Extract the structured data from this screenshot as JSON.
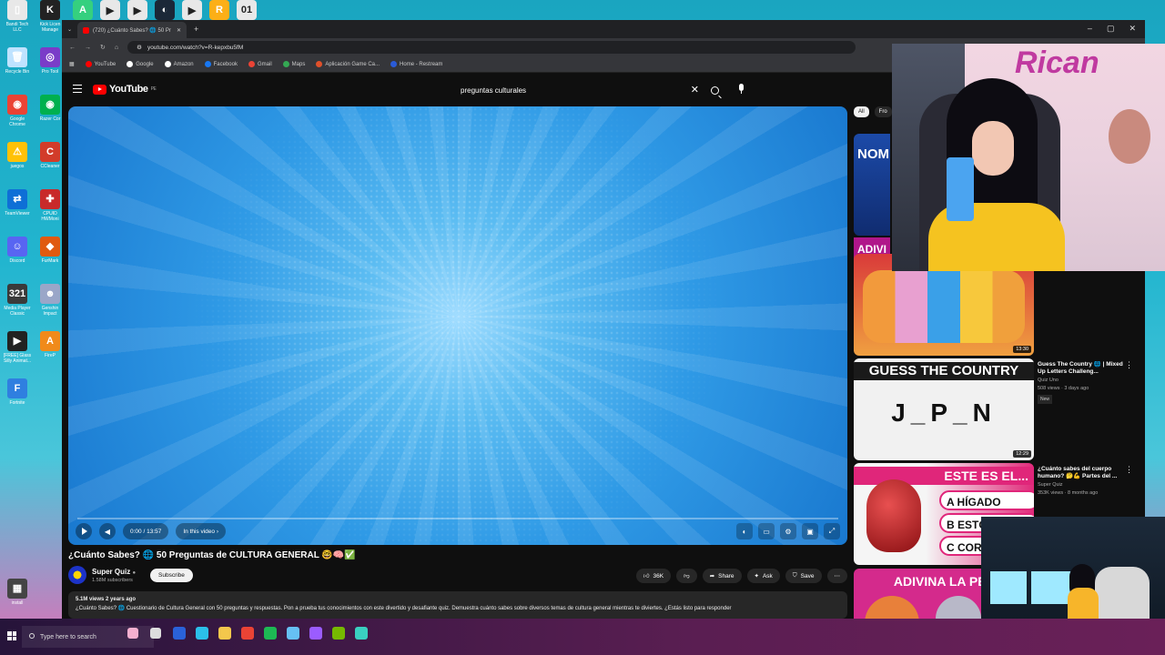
{
  "desktop": {
    "icons_col1": [
      {
        "label": "Bandi Tech LLC",
        "color": "#e8e8e8",
        "glyph": "▯"
      },
      {
        "label": "Recycle Bin",
        "color": "#bfe3ff",
        "glyph": "🗑"
      },
      {
        "label": "Google Chrome",
        "color": "#ea4335",
        "glyph": "◉"
      },
      {
        "label": "juegos",
        "color": "#ffc107",
        "glyph": "⚠"
      },
      {
        "label": "TeamViewer",
        "color": "#0e6fd6",
        "glyph": "⇄"
      },
      {
        "label": "Discord",
        "color": "#5865f2",
        "glyph": "☺"
      },
      {
        "label": "Media Player Classic",
        "color": "#3a3a3a",
        "glyph": "321"
      },
      {
        "label": "[FREE] Glass Silly Animat...",
        "color": "#222",
        "glyph": "▶"
      },
      {
        "label": "Fortnite",
        "color": "#2f7fe0",
        "glyph": "F"
      },
      {
        "label": "install",
        "color": "#444",
        "glyph": "▦"
      }
    ],
    "icons_col2": [
      {
        "label": "Kick Licen Manage",
        "color": "#222",
        "glyph": "K"
      },
      {
        "label": "Pro Tool",
        "color": "#7a3cc8",
        "glyph": "◎"
      },
      {
        "label": "Razer Cor",
        "color": "#00b04f",
        "glyph": "◉"
      },
      {
        "label": "CCleaner",
        "color": "#d23c2a",
        "glyph": "C"
      },
      {
        "label": "CPUID HWMoni",
        "color": "#c82a2a",
        "glyph": "✚"
      },
      {
        "label": "FurMark",
        "color": "#e05a10",
        "glyph": "◆"
      },
      {
        "label": "Genshin Impact",
        "color": "#9aa6c8",
        "glyph": "☻"
      },
      {
        "label": "FireP",
        "color": "#f08a1a",
        "glyph": "A"
      }
    ],
    "top_apps": [
      {
        "name": "kick-app",
        "color": "#35d07f",
        "glyph": "A"
      },
      {
        "name": "obs-app",
        "color": "#e8e8e8",
        "glyph": "▶"
      },
      {
        "name": "obs-app-2",
        "color": "#e8e8e8",
        "glyph": "▶"
      },
      {
        "name": "steam-app",
        "color": "#1b2838",
        "glyph": "◐"
      },
      {
        "name": "obs-app-3",
        "color": "#e8e8e8",
        "glyph": "▶"
      },
      {
        "name": "rockstar-app",
        "color": "#fcaf17",
        "glyph": "R"
      },
      {
        "name": "file-app",
        "color": "#e8e8e8",
        "glyph": "01"
      }
    ]
  },
  "browser": {
    "tab_title": "(720) ¿Cuánto Sabes? 🌐 50 Pr",
    "url": "youtube.com/watch?v=R-kepxbu5fM",
    "bookmarks": [
      {
        "label": "YouTube",
        "color": "#ff0000"
      },
      {
        "label": "Google",
        "color": "#ffffff"
      },
      {
        "label": "Amazon",
        "color": "#ffffff"
      },
      {
        "label": "Facebook",
        "color": "#1877f2"
      },
      {
        "label": "Gmail",
        "color": "#ea4335"
      },
      {
        "label": "Maps",
        "color": "#34a853"
      },
      {
        "label": "Aplicación Game Ca...",
        "color": "#e0502a"
      },
      {
        "label": "Home - Restream",
        "color": "#2a5bd7"
      }
    ]
  },
  "youtube": {
    "logo_text": "YouTube",
    "logo_country": "PE",
    "search_value": "preguntas culturales",
    "player": {
      "time": "0:00 / 13:57",
      "in_this_video": "In this video ›",
      "progress": 0
    },
    "video_title": "¿Cuánto Sabes? 🌐 50 Preguntas de CULTURA GENERAL 🤓🧠✅",
    "channel": {
      "name": "Super Quiz",
      "subscribers": "1.58M subscribers",
      "subscribe_label": "Subscribe"
    },
    "actions": {
      "likes": "36K",
      "share": "Share",
      "ask": "Ask",
      "save": "Save"
    },
    "description": {
      "meta": "5.1M views  2 years ago",
      "text": "¿Cuánto Sabes? 🌐 Cuestionario de Cultura General con 50 preguntas y respuestas. Pon a prueba tus conocimientos con este divertido y desafiante quiz. Demuestra cuánto sabes sobre diversos temas de cultura general mientras te diviertes. ¿Estás listo para responder"
    },
    "chips": [
      "All",
      "Fro"
    ],
    "sidebar_partial": {
      "top_text": "NOM",
      "mid_text": "ADIVI"
    },
    "recommendations": [
      {
        "thumb_top": "",
        "thumb_line2": "",
        "duration": "13:30",
        "title": "",
        "channel": "",
        "meta": "",
        "badge": ""
      },
      {
        "thumb_top": "GUESS THE COUNTRY",
        "thumb_line2": "J_P_N",
        "duration": "12:29",
        "title": "Guess The Country 🌐 | Mixed Up Letters Challeng...",
        "channel": "Quiz Uno",
        "meta": "508 views · 3 days ago",
        "badge": "New"
      },
      {
        "thumb_top": "ESTE ES EL...",
        "thumb_line2": "",
        "options": [
          "A HÍGADO",
          "B ESTÓMAGO",
          "C COR"
        ],
        "duration": "",
        "title": "¿Cuánto sabes del cuerpo humano? 🤔💪 Partes del ...",
        "channel": "Super Quiz",
        "meta": "353K views · 8 months ago",
        "badge": ""
      },
      {
        "thumb_top": "ADIVINA LA PEL",
        "thumb_line2": "",
        "duration": "",
        "title": "",
        "channel": "",
        "meta": "",
        "badge": ""
      }
    ]
  },
  "webcam": {
    "banner": "Rican"
  },
  "taskbar": {
    "search_placeholder": "Type here to search",
    "apps": [
      {
        "name": "copilot-icon",
        "color": "#f5b0d0"
      },
      {
        "name": "task-view-icon",
        "color": "#dddddd"
      },
      {
        "name": "steam-taskbar-icon",
        "color": "#2a62d9"
      },
      {
        "name": "edge-icon",
        "color": "#2bc0ea"
      },
      {
        "name": "explorer-icon",
        "color": "#f3c74c"
      },
      {
        "name": "chrome-taskbar-icon",
        "color": "#ea4335"
      },
      {
        "name": "spotify-icon",
        "color": "#1db954"
      },
      {
        "name": "steam-icon",
        "color": "#66c0f4"
      },
      {
        "name": "pro-tool-icon",
        "color": "#9b5cff"
      },
      {
        "name": "nvidia-icon",
        "color": "#76b900"
      },
      {
        "name": "app-icon",
        "color": "#3ad0c0"
      }
    ]
  }
}
